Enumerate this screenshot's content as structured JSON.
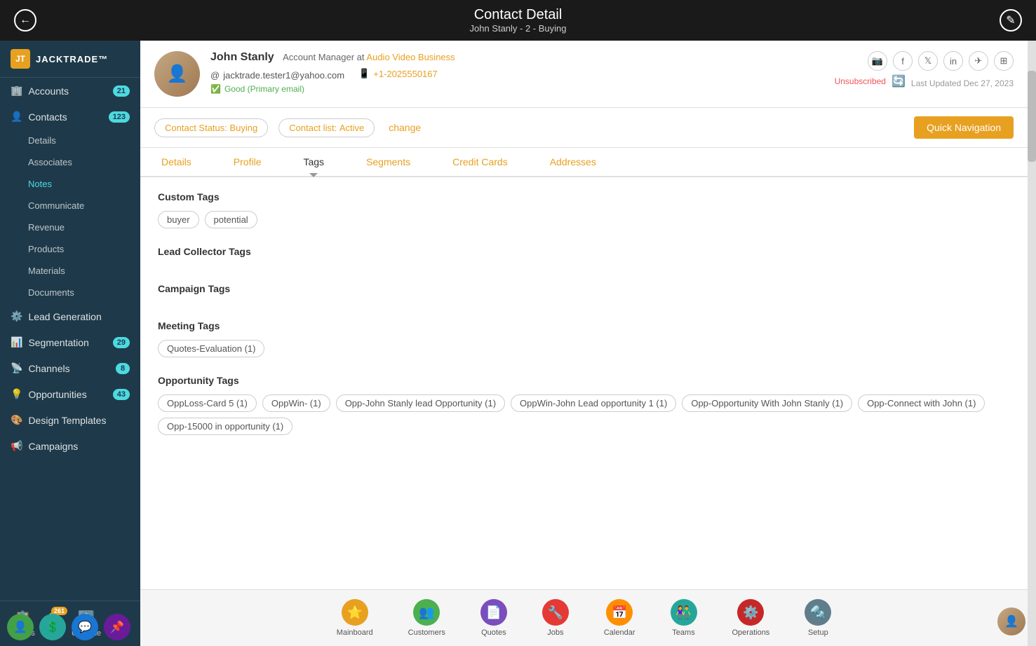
{
  "topbar": {
    "title": "Contact Detail",
    "subtitle": "John Stanly - 2 - Buying"
  },
  "sidebar": {
    "logo": "JT",
    "logo_name": "JACKTRADE™",
    "items": [
      {
        "id": "accounts",
        "label": "Accounts",
        "badge": "21",
        "icon": "🏢"
      },
      {
        "id": "contacts",
        "label": "Contacts",
        "badge": "123",
        "icon": "👤"
      },
      {
        "id": "details",
        "label": "Details",
        "sub": true
      },
      {
        "id": "associates",
        "label": "Associates",
        "sub": true
      },
      {
        "id": "notes",
        "label": "Notes",
        "sub": true,
        "active": true
      },
      {
        "id": "communicate",
        "label": "Communicate",
        "sub": true
      },
      {
        "id": "revenue",
        "label": "Revenue",
        "sub": true
      },
      {
        "id": "products",
        "label": "Products",
        "sub": true
      },
      {
        "id": "materials",
        "label": "Materials",
        "sub": true
      },
      {
        "id": "documents",
        "label": "Documents",
        "sub": true
      },
      {
        "id": "lead_generation",
        "label": "Lead Generation",
        "icon": "⚙️"
      },
      {
        "id": "segmentation",
        "label": "Segmentation",
        "badge": "29",
        "icon": "📊"
      },
      {
        "id": "channels",
        "label": "Channels",
        "badge": "8",
        "icon": "📡"
      },
      {
        "id": "opportunities",
        "label": "Opportunities",
        "badge": "43",
        "icon": "💡"
      },
      {
        "id": "design_templates",
        "label": "Design Templates",
        "icon": "🎨"
      },
      {
        "id": "campaigns",
        "label": "Campaigns",
        "icon": "📢"
      }
    ],
    "bottom": [
      {
        "id": "guides",
        "label": "Guides",
        "icon": "📋"
      },
      {
        "id": "alerts",
        "label": "Alerts",
        "icon": "🔔",
        "badge": "261"
      },
      {
        "id": "upgrade",
        "label": "Upgrade",
        "icon": "⬆️"
      }
    ]
  },
  "contact": {
    "name": "John Stanly",
    "role": "Account Manager",
    "company": "Audio Video Business",
    "email": "jacktrade.tester1@yahoo.com",
    "phone": "+1-2025550167",
    "email_status": "Good (Primary email)",
    "subscription_status": "Unsubscribed",
    "last_updated": "Last Updated Dec 27, 2023",
    "contact_status_label": "Contact Status:",
    "contact_status_value": "Buying",
    "contact_list_label": "Contact list:",
    "contact_list_value": "Active",
    "change_label": "change",
    "quick_nav_label": "Quick Navigation"
  },
  "tabs": [
    {
      "id": "details",
      "label": "Details"
    },
    {
      "id": "profile",
      "label": "Profile"
    },
    {
      "id": "tags",
      "label": "Tags",
      "active": true
    },
    {
      "id": "segments",
      "label": "Segments"
    },
    {
      "id": "credit_cards",
      "label": "Credit Cards"
    },
    {
      "id": "addresses",
      "label": "Addresses"
    }
  ],
  "tags": {
    "custom_tags": {
      "title": "Custom Tags",
      "items": [
        "buyer",
        "potential"
      ]
    },
    "lead_collector_tags": {
      "title": "Lead Collector Tags",
      "items": []
    },
    "campaign_tags": {
      "title": "Campaign Tags",
      "items": []
    },
    "meeting_tags": {
      "title": "Meeting Tags",
      "items": [
        "Quotes-Evaluation (1)"
      ]
    },
    "opportunity_tags": {
      "title": "Opportunity Tags",
      "items": [
        "OppLoss-Card 5 (1)",
        "OppWin- (1)",
        "Opp-John Stanly lead Opportunity (1)",
        "OppWin-John Lead opportunity 1 (1)",
        "Opp-Opportunity With John Stanly (1)",
        "Opp-Connect with John (1)",
        "Opp-15000 in opportunity (1)"
      ]
    }
  },
  "bottom_nav": [
    {
      "id": "mainboard",
      "label": "Mainboard",
      "color": "orange",
      "icon": "⭐"
    },
    {
      "id": "customers",
      "label": "Customers",
      "color": "green",
      "icon": "👥"
    },
    {
      "id": "quotes",
      "label": "Quotes",
      "color": "purple",
      "icon": "📄"
    },
    {
      "id": "jobs",
      "label": "Jobs",
      "color": "red",
      "icon": "🔧"
    },
    {
      "id": "calendar",
      "label": "Calendar",
      "color": "amber",
      "icon": "📅"
    },
    {
      "id": "teams",
      "label": "Teams",
      "color": "teal",
      "icon": "👫"
    },
    {
      "id": "operations",
      "label": "Operations",
      "color": "crimson",
      "icon": "⚙️"
    },
    {
      "id": "setup",
      "label": "Setup",
      "color": "gray",
      "icon": "🔩"
    }
  ]
}
